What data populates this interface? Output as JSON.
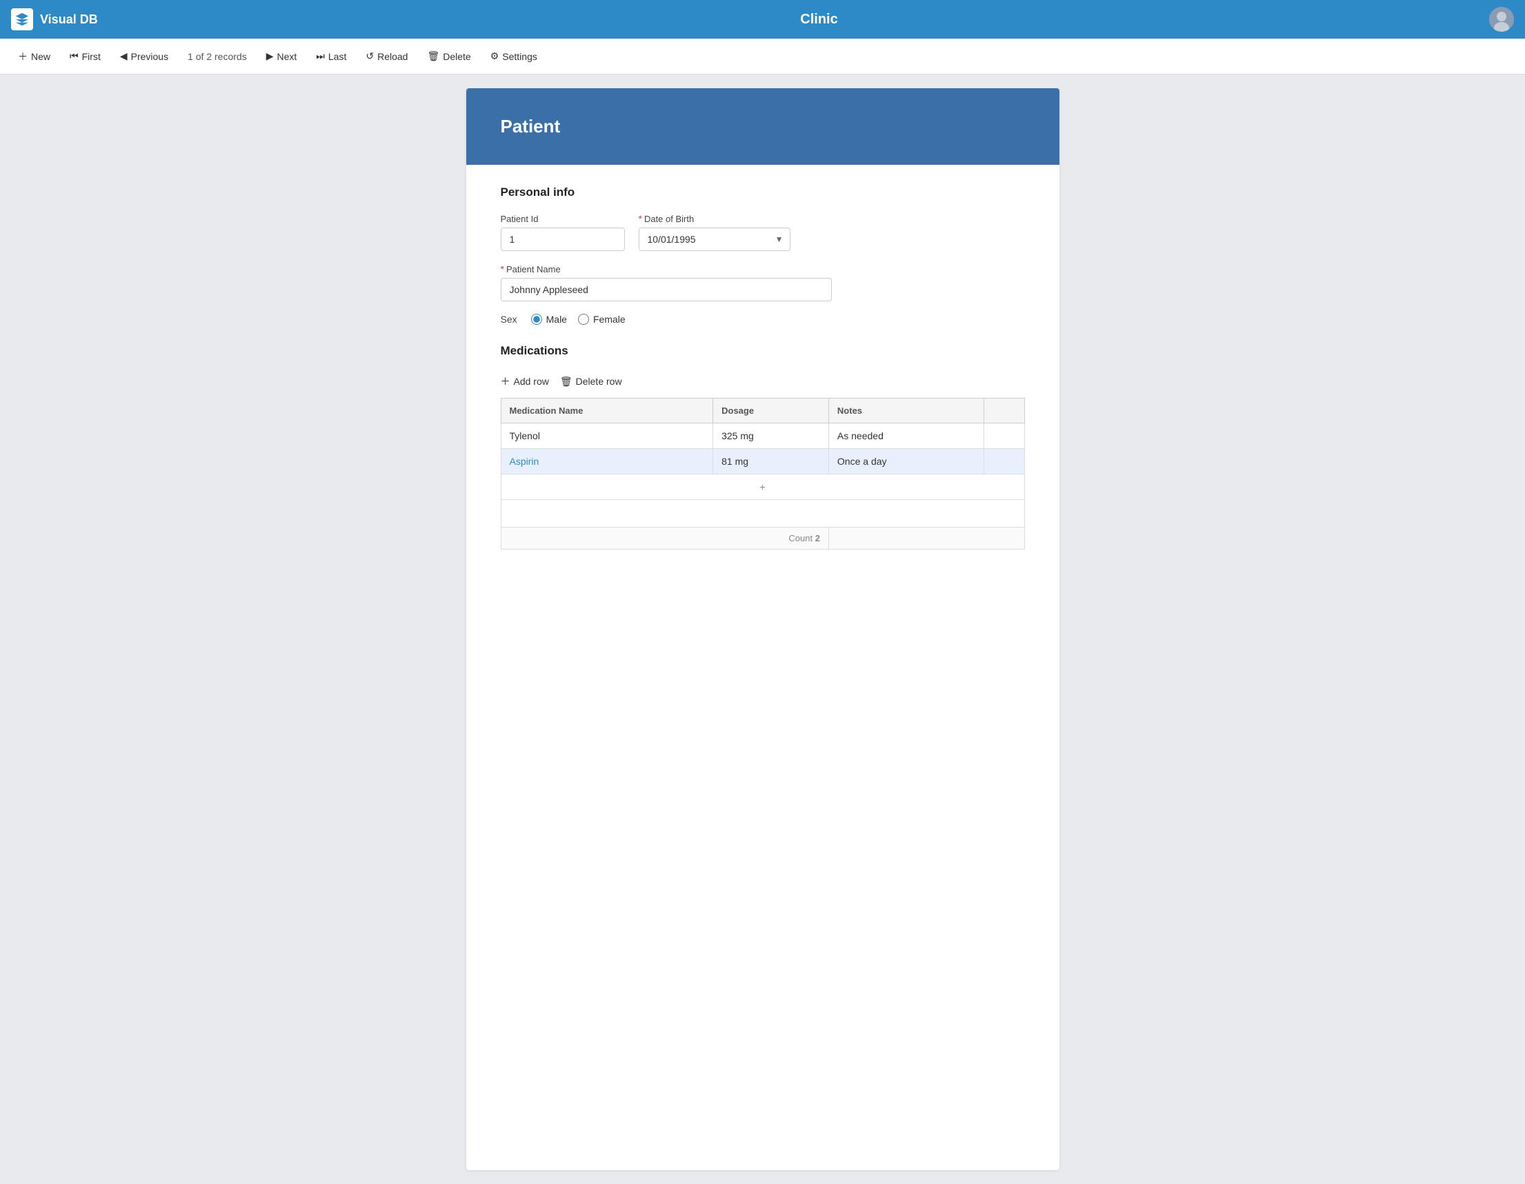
{
  "app": {
    "name": "Visual DB",
    "clinic": "Clinic"
  },
  "toolbar": {
    "new_label": "New",
    "first_label": "First",
    "previous_label": "Previous",
    "record_count": "1 of 2 records",
    "next_label": "Next",
    "last_label": "Last",
    "reload_label": "Reload",
    "delete_label": "Delete",
    "settings_label": "Settings"
  },
  "form": {
    "header_title": "Patient",
    "personal_info_title": "Personal info",
    "patient_id_label": "Patient Id",
    "patient_id_value": "1",
    "dob_label": "Date of Birth",
    "dob_value": "10/01/1995",
    "patient_name_label": "Patient Name",
    "patient_name_value": "Johnny Appleseed",
    "sex_label": "Sex",
    "sex_male": "Male",
    "sex_female": "Female",
    "sex_selected": "Male",
    "medications_title": "Medications",
    "add_row_label": "Add row",
    "delete_row_label": "Delete row",
    "table_headers": [
      "Medication Name",
      "Dosage",
      "Notes",
      ""
    ],
    "medications": [
      {
        "name": "Tylenol",
        "dosage": "325 mg",
        "notes": "As needed",
        "selected": false
      },
      {
        "name": "Aspirin",
        "dosage": "81 mg",
        "notes": "Once a day",
        "selected": true
      }
    ],
    "count_label": "Count",
    "count_value": "2"
  }
}
